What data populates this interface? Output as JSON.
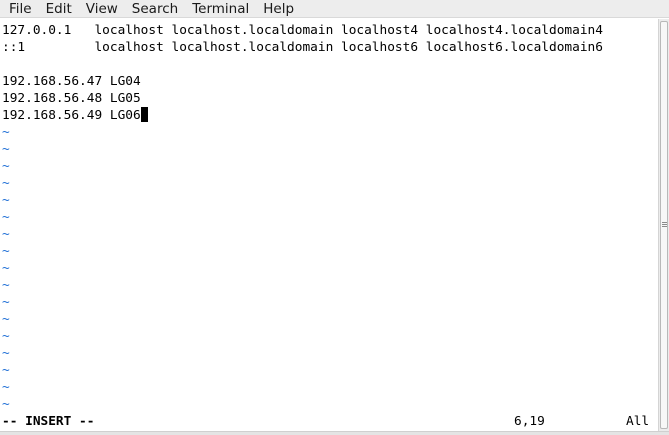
{
  "menubar": {
    "items": [
      {
        "label": "File"
      },
      {
        "label": "Edit"
      },
      {
        "label": "View"
      },
      {
        "label": "Search"
      },
      {
        "label": "Terminal"
      },
      {
        "label": "Help"
      }
    ]
  },
  "editor": {
    "lines": [
      "127.0.0.1   localhost localhost.localdomain localhost4 localhost4.localdomain4",
      "::1         localhost localhost.localdomain localhost6 localhost6.localdomain6",
      "",
      "192.168.56.47 LG04",
      "192.168.56.48 LG05",
      "192.168.56.49 LG06"
    ],
    "empty_line_marker": "~",
    "cursor_position": {
      "line": 6,
      "column": 19
    }
  },
  "statusline": {
    "mode": "-- INSERT --",
    "position": "6,19",
    "scroll": "All"
  },
  "colors": {
    "tilde": "#1f6fd6",
    "menubar_bg": "#ededed",
    "background": "#ffffff"
  }
}
